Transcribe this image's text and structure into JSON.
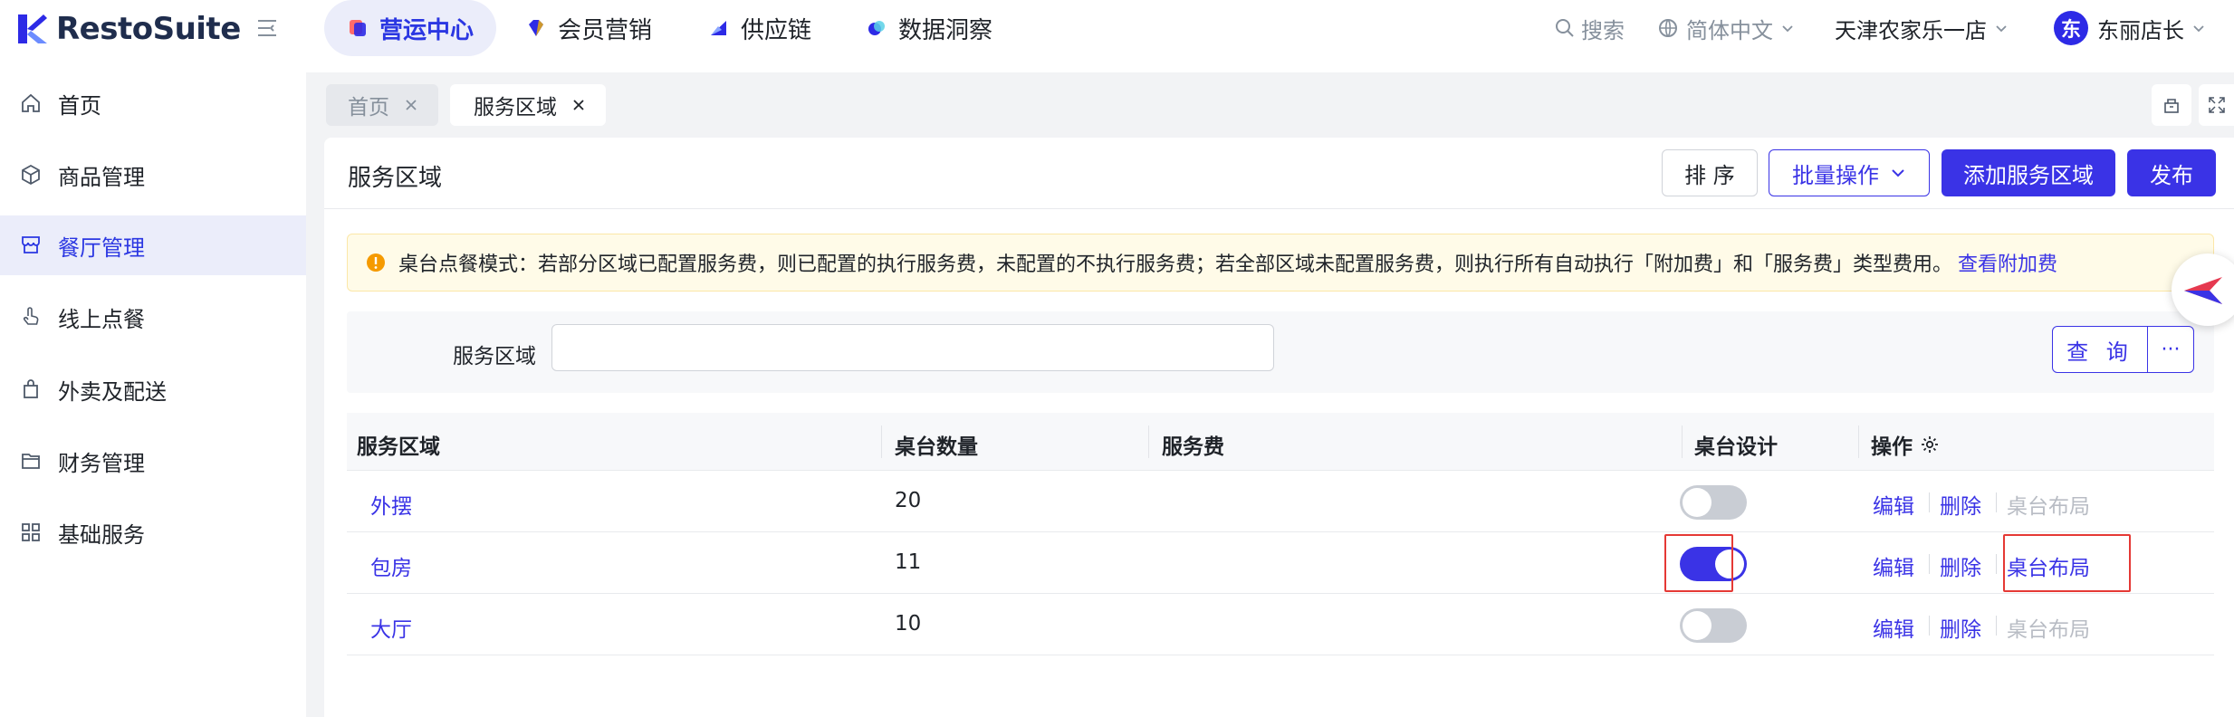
{
  "header": {
    "brand": "RestoSuite",
    "nav_tabs": [
      {
        "label": "营运中心",
        "active": true
      },
      {
        "label": "会员营销",
        "active": false
      },
      {
        "label": "供应链",
        "active": false
      },
      {
        "label": "数据洞察",
        "active": false
      }
    ],
    "search_label": "搜索",
    "language": "简体中文",
    "store": "天津农家乐一店",
    "avatar_char": "东",
    "user": "东丽店长"
  },
  "sidebar": {
    "items": [
      {
        "label": "首页",
        "icon": "home-icon",
        "active": false
      },
      {
        "label": "商品管理",
        "icon": "box-icon",
        "active": false
      },
      {
        "label": "餐厅管理",
        "icon": "store-icon",
        "active": true
      },
      {
        "label": "线上点餐",
        "icon": "hand-tap-icon",
        "active": false
      },
      {
        "label": "外卖及配送",
        "icon": "bag-icon",
        "active": false
      },
      {
        "label": "财务管理",
        "icon": "folder-icon",
        "active": false
      },
      {
        "label": "基础服务",
        "icon": "grid-icon",
        "active": false
      }
    ]
  },
  "page_tabs": [
    {
      "label": "首页",
      "active": false
    },
    {
      "label": "服务区域",
      "active": true
    }
  ],
  "content": {
    "title": "服务区域",
    "buttons": {
      "sort": "排 序",
      "batch": "批量操作",
      "add": "添加服务区域",
      "publish": "发布"
    },
    "alert": {
      "text": "桌台点餐模式：若部分区域已配置服务费，则已配置的执行服务费，未配置的不执行服务费；若全部区域未配置服务费，则执行所有自动执行「附加费」和「服务费」类型费用。",
      "link": "查看附加费"
    },
    "filter": {
      "label": "服务区域",
      "value": "",
      "query_button": "查 询",
      "more_button": "···"
    },
    "table": {
      "columns": [
        "服务区域",
        "桌台数量",
        "服务费",
        "桌台设计",
        "操作"
      ],
      "rows": [
        {
          "area": "外摆",
          "count": "20",
          "fee": "",
          "design_on": false,
          "actions": [
            "编辑",
            "删除",
            "桌台布局"
          ]
        },
        {
          "area": "包房",
          "count": "11",
          "fee": "",
          "design_on": true,
          "actions": [
            "编辑",
            "删除",
            "桌台布局"
          ]
        },
        {
          "area": "大厅",
          "count": "10",
          "fee": "",
          "design_on": false,
          "actions": [
            "编辑",
            "删除",
            "桌台布局"
          ]
        }
      ]
    }
  },
  "colors": {
    "primary": "#3a33e6",
    "active_bg": "#ebedfa",
    "alert_bg": "#fffbe8",
    "highlight": "#e53935"
  }
}
